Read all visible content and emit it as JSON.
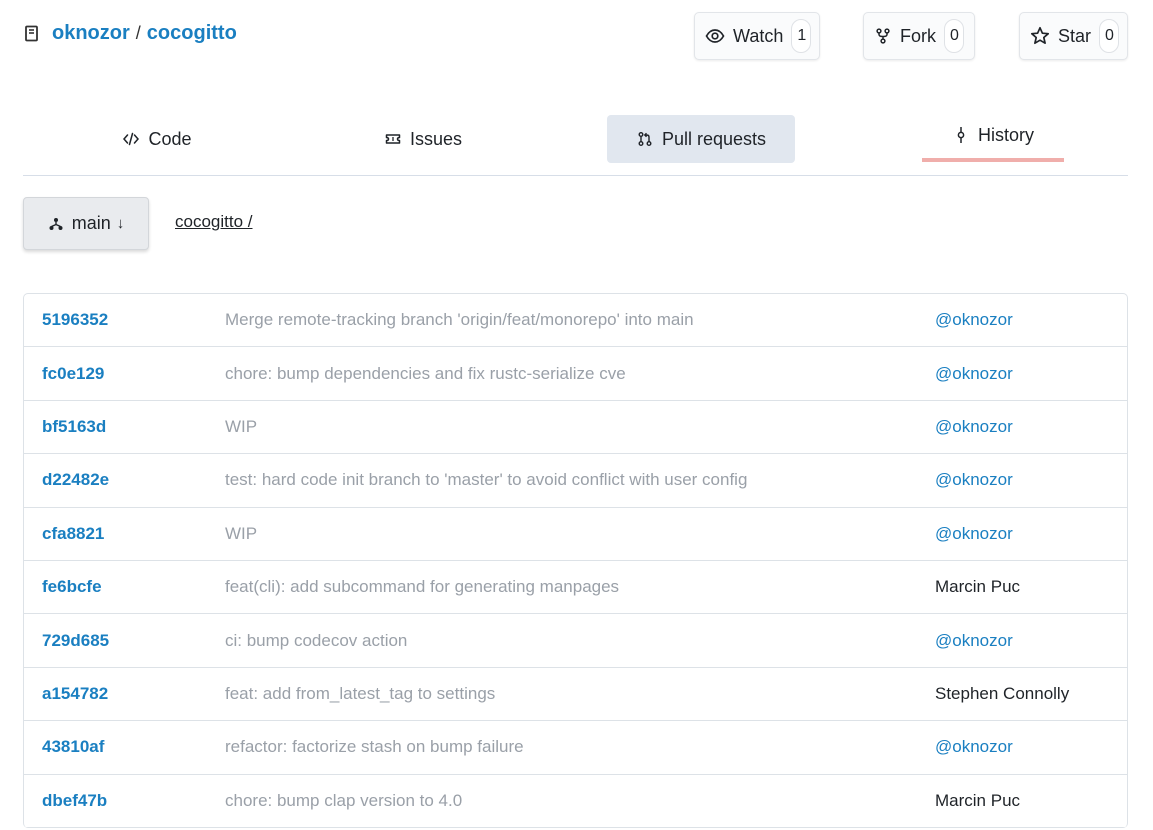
{
  "repo": {
    "owner": "oknozor",
    "separator": "/",
    "name": "cocogitto"
  },
  "actions": {
    "watch": {
      "label": "Watch",
      "count": "1",
      "icon": "eye-icon"
    },
    "fork": {
      "label": "Fork",
      "count": "0",
      "icon": "fork-icon"
    },
    "star": {
      "label": "Star",
      "count": "0",
      "icon": "star-icon"
    }
  },
  "tabs": [
    {
      "label": "Code",
      "icon": "code-icon"
    },
    {
      "label": "Issues",
      "icon": "ticket-icon"
    },
    {
      "label": "Pull requests",
      "icon": "pull-request-icon",
      "active_bg": "#e1e7ef"
    },
    {
      "label": "History",
      "icon": "commit-icon",
      "underline": "#f0aeab"
    }
  ],
  "branch": {
    "label": "main",
    "arrow": "↓",
    "icon": "branch-icon"
  },
  "path": "cocogitto /",
  "colors": {
    "link": "#1a7fc1",
    "muted": "#9aa0a8"
  },
  "commits": [
    {
      "sha": "5196352",
      "message": "Merge remote-tracking branch 'origin/feat/monorepo' into main",
      "author": "@oknozor"
    },
    {
      "sha": "fc0e129",
      "message": "chore: bump dependencies and fix rustc-serialize cve",
      "author": "@oknozor"
    },
    {
      "sha": "bf5163d",
      "message": "WIP",
      "author": "@oknozor"
    },
    {
      "sha": "d22482e",
      "message": "test: hard code init branch to 'master' to avoid conflict with user config",
      "author": "@oknozor"
    },
    {
      "sha": "cfa8821",
      "message": "WIP",
      "author": "@oknozor"
    },
    {
      "sha": "fe6bcfe",
      "message": "feat(cli): add subcommand for generating manpages",
      "author": "Marcin Puc"
    },
    {
      "sha": "729d685",
      "message": "ci: bump codecov action",
      "author": "@oknozor"
    },
    {
      "sha": "a154782",
      "message": "feat: add from_latest_tag to settings",
      "author": "Stephen Connolly"
    },
    {
      "sha": "43810af",
      "message": "refactor: factorize stash on bump failure",
      "author": "@oknozor"
    },
    {
      "sha": "dbef47b",
      "message": "chore: bump clap version to 4.0",
      "author": "Marcin Puc"
    }
  ]
}
